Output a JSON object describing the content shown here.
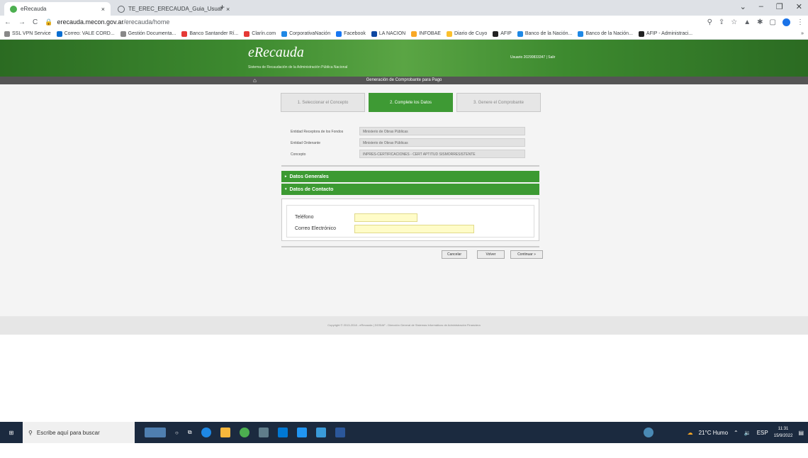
{
  "browser": {
    "tabs": [
      {
        "label": "eRecauda",
        "close": "×"
      },
      {
        "label": "TE_EREC_ERECAUDA_Guia_Usuar",
        "close": "×"
      }
    ],
    "new_tab": "+",
    "url_host": "erecauda.mecon.gov.ar",
    "url_path": "/erecauda/home",
    "bookmarks": [
      "SSL VPN Service",
      "Correo: VALE CORD...",
      "Gestión Documenta...",
      "Banco Santander Rí...",
      "Clarín.com",
      "CorporativaNación",
      "Facebook",
      "LA NACION",
      "INFOBAE",
      "Diario de Cuyo",
      "AFIP",
      "Banco de la Nación...",
      "Banco de la Nación...",
      "AFIP - Administraci..."
    ],
    "more": "»"
  },
  "header": {
    "logo": "eRecauda",
    "subtitle": "Sistema de Recaudación de la Administración Pública Nacional",
    "user": "Usuario 20290833347 | Salir"
  },
  "nav": {
    "title": "Generación de Comprobante para Pago"
  },
  "steps": [
    "1. Seleccionar el Concepto",
    "2. Complete los Datos",
    "3. Genere el Comprobante"
  ],
  "info": [
    {
      "label": "Entidad Receptora de los Fondos",
      "value": "Ministerio de Obras Públicas"
    },
    {
      "label": "Entidad Ordenante",
      "value": "Ministerio de Obras Públicas"
    },
    {
      "label": "Concepto",
      "value": "INPRES-CERTIFICACIONES - CERT APTITUD SISMORRESISTENTE"
    }
  ],
  "sections": {
    "general": "Datos Generales",
    "contact": "Datos de Contacto"
  },
  "form": {
    "phone_label": "Teléfono",
    "email_label": "Correo Electrónico",
    "phone_value": "",
    "email_value": ""
  },
  "buttons": {
    "cancel": "Cancelar",
    "back": "Volver",
    "continue": "Continuar »"
  },
  "footer": "Copyright © 2013-2018 - eRecauda | DGSIAF - Dirección General de Sistemas Informáticos de Administración Financiera",
  "taskbar": {
    "search": "Escribe aquí para buscar",
    "weather": "21°C Humo",
    "lang": "ESP",
    "time": "11:31",
    "date": "15/9/2022"
  }
}
